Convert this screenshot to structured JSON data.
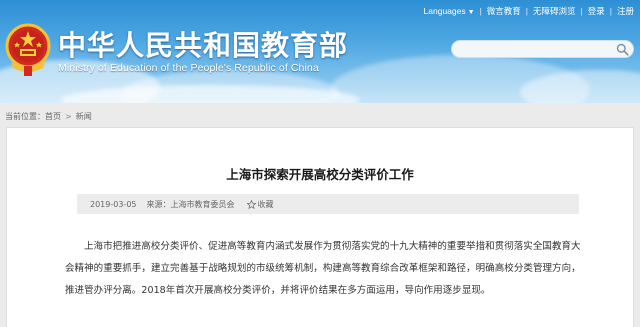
{
  "header": {
    "title_cn": "中华人民共和国教育部",
    "title_en": "Ministry of Education of the People's Republic of China",
    "links": {
      "languages": "Languages",
      "weibo": "微言教育",
      "accessible": "无障碍浏览",
      "login": "登录",
      "register": "注册"
    },
    "search": {
      "placeholder": ""
    }
  },
  "breadcrumb": {
    "prefix": "当前位置：",
    "items": [
      "首页",
      "新闻"
    ]
  },
  "article": {
    "title": "上海市探索开展高校分类评价工作",
    "date": "2019-03-05",
    "source": "来源：上海市教育委员会",
    "favorite": "收藏",
    "body": "上海市把推进高校分类评价、促进高等教育内涵式发展作为贯彻落实党的十九大精神的重要举措和贯彻落实全国教育大会精神的重要抓手，建立完善基于战略规划的市级统筹机制，构建高等教育综合改革框架和路径，明确高校分类管理方向，推进管办评分离。2018年首次开展高校分类评价，并将评价结果在多方面运用，导向作用逐步显现。"
  },
  "colors": {
    "header_blue": "#2d8fd4",
    "page_bg": "#ebebeb",
    "meta_bg": "#ececec"
  },
  "icons": [
    "national-emblem",
    "search-icon",
    "star-icon"
  ]
}
